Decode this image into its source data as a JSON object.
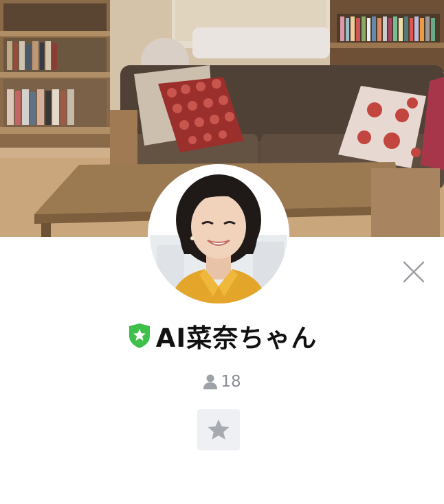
{
  "profile": {
    "name": "AI菜奈ちゃん",
    "friend_count": "18",
    "badge_color": "#3ec04a"
  },
  "icons": {
    "official_badge": "shield-star-icon",
    "friends": "person-icon",
    "close": "close-icon",
    "favorite": "star-icon"
  },
  "colors": {
    "text_primary": "#111111",
    "text_secondary": "#8a8d93",
    "button_bg": "#eef0f3"
  }
}
